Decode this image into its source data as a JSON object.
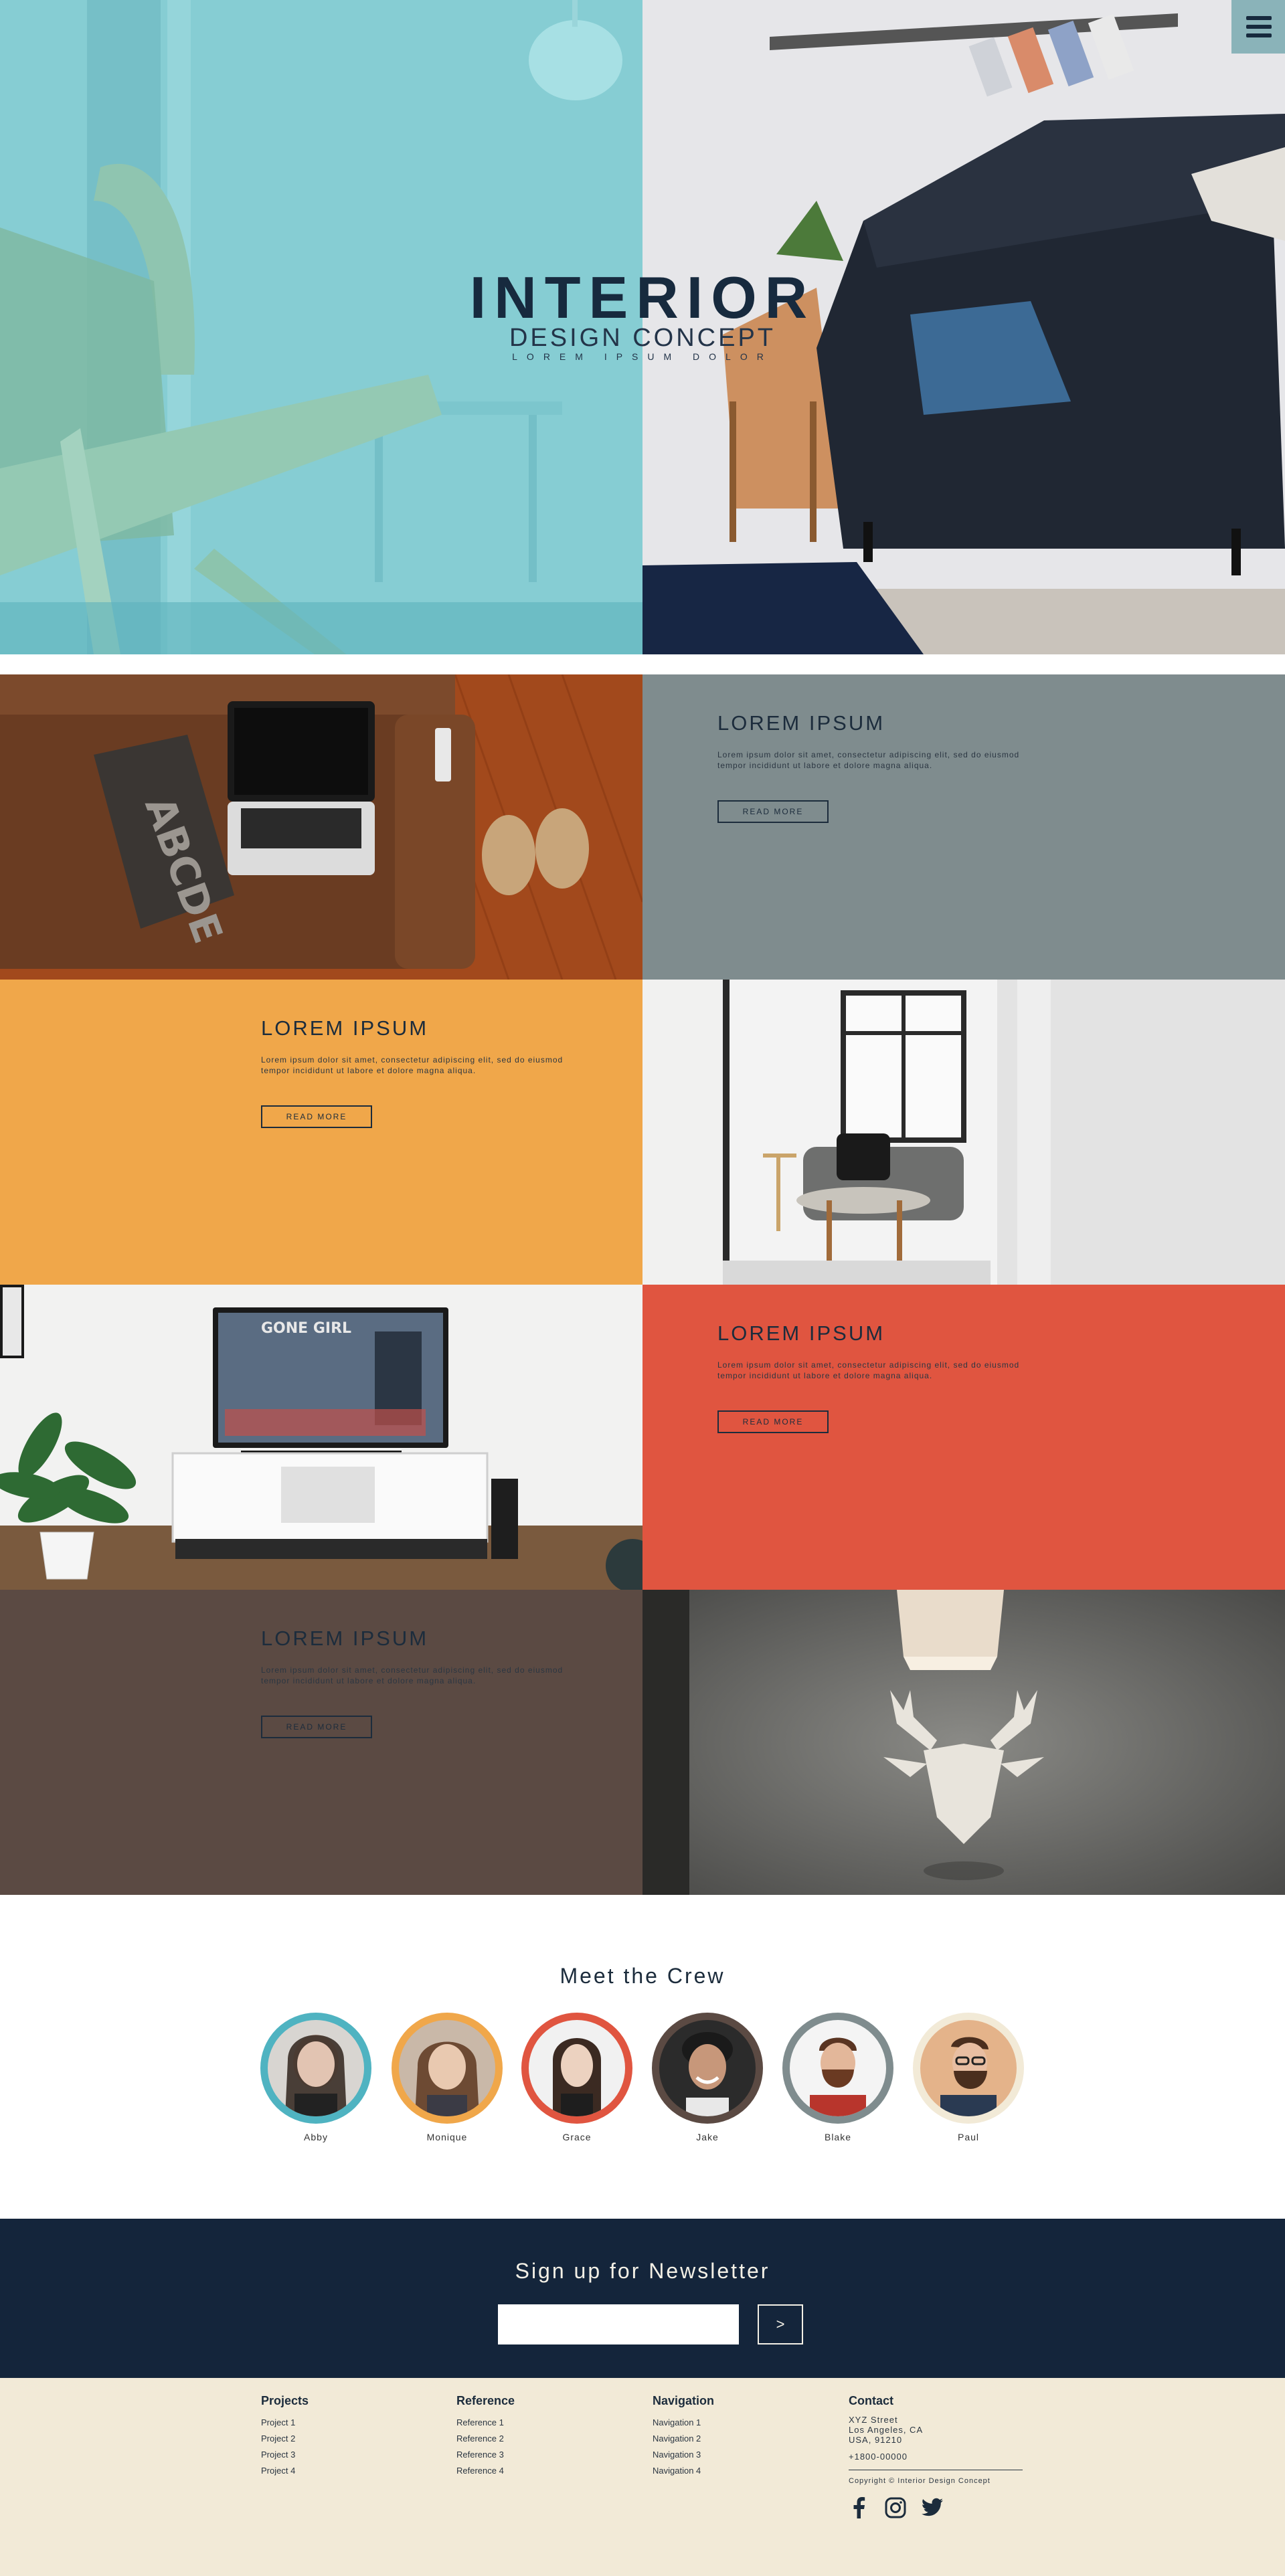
{
  "hero": {
    "title": "INTERIOR",
    "subtitle": "DESIGN CONCEPT",
    "tagline": "LOREM IPSUM DOLOR",
    "menu_icon": "hamburger-menu-icon"
  },
  "sections": [
    {
      "heading": "LOREM IPSUM",
      "body": "Lorem ipsum dolor sit amet, consectetur adipiscing elit, sed do eiusmod tempor incididunt ut labore et dolore magna aliqua.",
      "button": "READ MORE",
      "bg": "#7f8c8e"
    },
    {
      "heading": "LOREM IPSUM",
      "body": "Lorem ipsum dolor sit amet, consectetur adipiscing elit, sed do eiusmod tempor incididunt ut labore et dolore magna aliqua.",
      "button": "READ MORE",
      "bg": "#f0a74a"
    },
    {
      "heading": "LOREM IPSUM",
      "body": "Lorem ipsum dolor sit amet, consectetur adipiscing elit, sed do eiusmod tempor incididunt ut labore et dolore magna aliqua.",
      "button": "READ MORE",
      "bg": "#e05540"
    },
    {
      "heading": "LOREM IPSUM",
      "body": "Lorem ipsum dolor sit amet, consectetur adipiscing elit, sed do eiusmod tempor incididunt ut labore et dolore magna aliqua.",
      "button": "READ MORE",
      "bg": "#5b4a43"
    }
  ],
  "crew": {
    "title": "Meet the Crew",
    "members": [
      {
        "name": "Abby",
        "color": "#4fb3c1"
      },
      {
        "name": "Monique",
        "color": "#f0a74a"
      },
      {
        "name": "Grace",
        "color": "#e05540"
      },
      {
        "name": "Jake",
        "color": "#5b4a43"
      },
      {
        "name": "Blake",
        "color": "#7f8c8e"
      },
      {
        "name": "Paul",
        "color": "#f2ead7"
      }
    ]
  },
  "newsletter": {
    "title": "Sign up for Newsletter",
    "input_value": "",
    "button": ">"
  },
  "footer": {
    "projects": {
      "title": "Projects",
      "links": [
        "Project 1",
        "Project 2",
        "Project 3",
        "Project 4"
      ]
    },
    "reference": {
      "title": "Reference",
      "links": [
        "Reference 1",
        "Reference 2",
        "Reference 3",
        "Reference 4"
      ]
    },
    "navigation": {
      "title": "Navigation",
      "links": [
        "Navigation 1",
        "Navigation 2",
        "Navigation 3",
        "Navigation 4"
      ]
    },
    "contact": {
      "title": "Contact",
      "street": "XYZ Street",
      "city": "Los Angeles, CA",
      "country": "USA, 91210",
      "phone": "+1800-00000",
      "copyright": "Copyright © Interior Design Concept"
    },
    "social_icons": [
      "facebook-icon",
      "instagram-icon",
      "twitter-icon"
    ]
  },
  "colors": {
    "navy": "#14253b",
    "teal": "#8ad0d6",
    "grey": "#7f8c8e",
    "orange": "#f0a74a",
    "red": "#e05540",
    "brown": "#5b4a43",
    "cream": "#f2ead7"
  }
}
